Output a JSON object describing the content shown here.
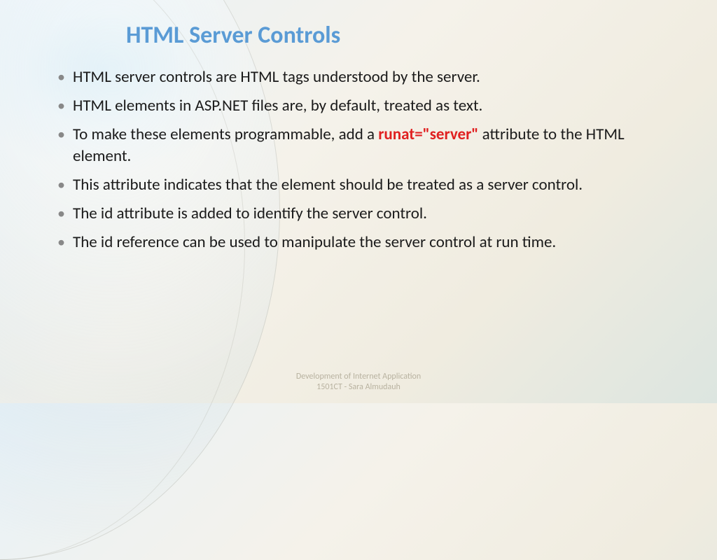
{
  "title": "HTML Server Controls",
  "bullets": [
    {
      "pre": "HTML server controls are HTML tags understood by the server.",
      "hl": "",
      "post": ""
    },
    {
      "pre": "HTML elements in ASP.NET files are, by default, treated as text.",
      "hl": "",
      "post": ""
    },
    {
      "pre": "To make these elements programmable, add a ",
      "hl": "runat=\"server\"",
      "post": " attribute to the HTML element."
    },
    {
      "pre": "This attribute indicates that the element should be treated as a server control.",
      "hl": "",
      "post": ""
    },
    {
      "pre": "The id attribute is added to identify the server control.",
      "hl": "",
      "post": ""
    },
    {
      "pre": "The id reference can be used to manipulate the server control at run time.",
      "hl": "",
      "post": ""
    }
  ],
  "footer": {
    "line1": "Development of Internet Application",
    "line2": "1501CT - Sara Almudauh"
  }
}
